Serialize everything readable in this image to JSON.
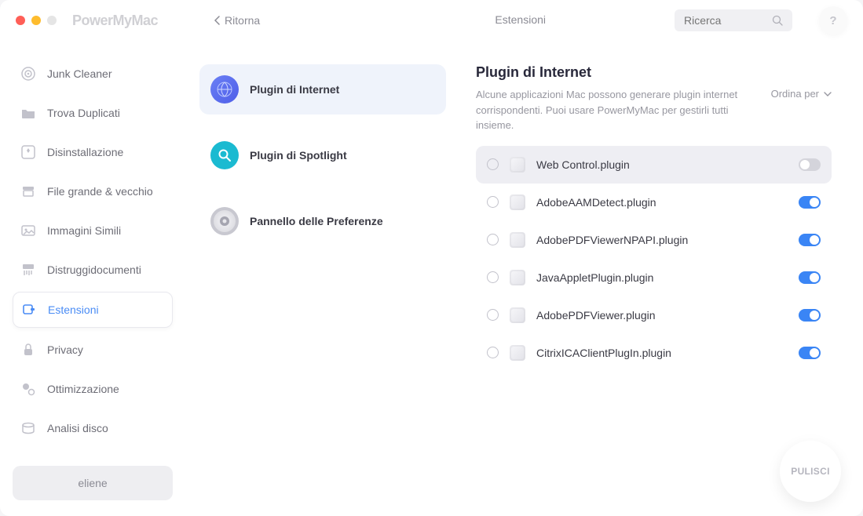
{
  "app": {
    "title": "PowerMyMac",
    "back": "Ritorna"
  },
  "header": {
    "tab": "Estensioni",
    "search_placeholder": "Ricerca"
  },
  "sidebar": {
    "items": [
      {
        "label": "Junk Cleaner",
        "icon": "radar"
      },
      {
        "label": "Trova Duplicati",
        "icon": "folder"
      },
      {
        "label": "Disinstallazione",
        "icon": "app"
      },
      {
        "label": "File grande & vecchio",
        "icon": "archive"
      },
      {
        "label": "Immagini Simili",
        "icon": "image"
      },
      {
        "label": "Distruggidocumenti",
        "icon": "shred"
      },
      {
        "label": "Estensioni",
        "icon": "ext"
      },
      {
        "label": "Privacy",
        "icon": "lock"
      },
      {
        "label": "Ottimizzazione",
        "icon": "rocket"
      },
      {
        "label": "Analisi disco",
        "icon": "disk"
      }
    ],
    "user": "eliene"
  },
  "categories": [
    {
      "label": "Plugin di Internet"
    },
    {
      "label": "Plugin di Spotlight"
    },
    {
      "label": "Pannello delle Preferenze"
    }
  ],
  "content": {
    "title": "Plugin di Internet",
    "desc": "Alcune applicazioni Mac possono generare plugin internet corrispondenti. Puoi usare PowerMyMac per gestirli tutti insieme.",
    "sort_label": "Ordina per",
    "plugins": [
      {
        "name": "Web Control.plugin",
        "enabled": false,
        "selected": true
      },
      {
        "name": "AdobeAAMDetect.plugin",
        "enabled": true,
        "selected": false
      },
      {
        "name": "AdobePDFViewerNPAPI.plugin",
        "enabled": true,
        "selected": false
      },
      {
        "name": "JavaAppletPlugin.plugin",
        "enabled": true,
        "selected": false
      },
      {
        "name": "AdobePDFViewer.plugin",
        "enabled": true,
        "selected": false
      },
      {
        "name": "CitrixICAClientPlugIn.plugin",
        "enabled": true,
        "selected": false
      }
    ]
  },
  "clean_btn": "PULISCI"
}
